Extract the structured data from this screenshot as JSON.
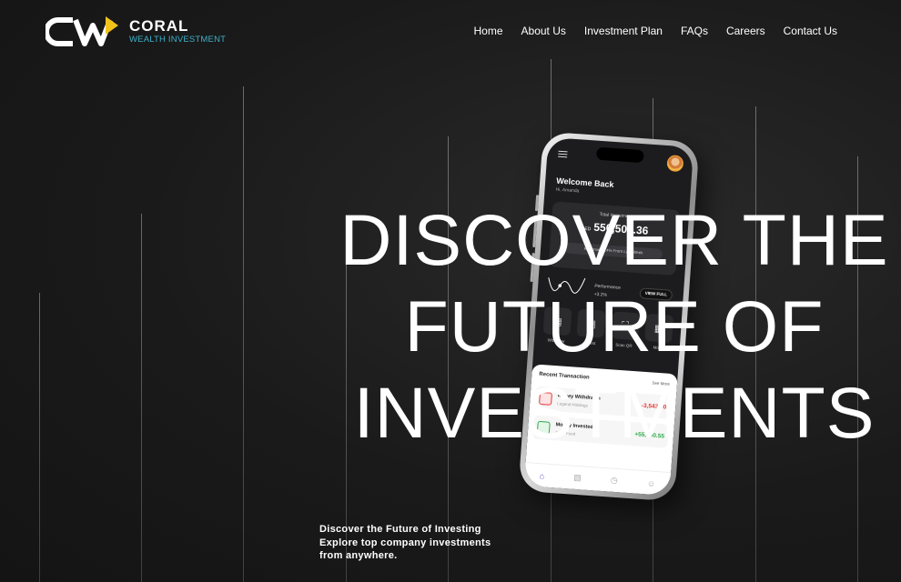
{
  "brand": {
    "name": "CORAL",
    "tagline": "WEALTH INVESTMENT",
    "accent": "#f2c21b",
    "tagline_color": "#3eb0c9"
  },
  "nav": {
    "items": [
      "Home",
      "About Us",
      "Investment Plan",
      "FAQs",
      "Careers",
      "Contact Us"
    ]
  },
  "hero": {
    "headline": [
      "DISCOVER THE",
      "FUTURE OF",
      "INVESTMENTS"
    ],
    "intro": [
      "Discover the Future of Investing",
      "Explore top company investments",
      "from anywhere."
    ]
  },
  "phone": {
    "welcome": "Welcome Back",
    "greeting": "Hi, Amanda",
    "card": {
      "label": "Total Investment",
      "currency": "AED",
      "value": "550,500.36",
      "revenue_note": "Revenue +14% From Last Week"
    },
    "performance": {
      "label": "Performance",
      "value": "+3.2%"
    },
    "view_button": "VIEW FULL",
    "actions": [
      {
        "label": "Withdraw",
        "icon": "wallet-icon"
      },
      {
        "label": "Invest",
        "icon": "invest-icon"
      },
      {
        "label": "Scan QR",
        "icon": "scan-icon"
      },
      {
        "label": "More",
        "icon": "grid-icon"
      }
    ],
    "recent": {
      "title": "Recent Transaction",
      "see_more": "See More",
      "transactions": [
        {
          "name": "Money Withdrawn",
          "sub": "Legend Holdings",
          "amount": "-3,543.00",
          "currency": "AED",
          "color": "#e53935"
        },
        {
          "name": "Money Invested",
          "sub": "Coral Fund",
          "amount": "+55,500.55",
          "currency": "AED",
          "color": "#2eaa4a"
        }
      ]
    }
  }
}
